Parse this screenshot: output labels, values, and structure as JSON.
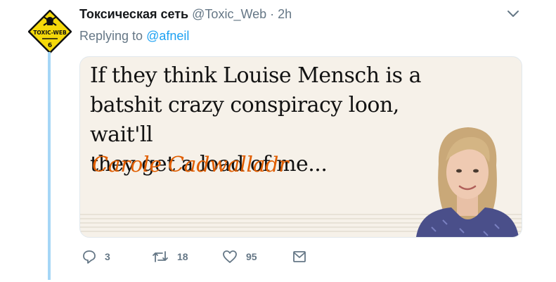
{
  "tweet": {
    "display_name": "Токсическая сеть",
    "handle": "@Toxic_Web",
    "separator": "·",
    "time": "2h",
    "avatar": {
      "icon": "toxic-web-sign-icon",
      "text": "TOXIC-WEB",
      "number": "6",
      "color": "#f5d90a"
    },
    "replying_prefix": "Replying to",
    "replying_handle": "@afneil"
  },
  "card": {
    "quote_line1": "If they think Louise Mensch is a",
    "quote_line2": "batshit crazy conspiracy loon, wait'll",
    "quote_line3": "they get a load of me...",
    "author": "Carole Cadwalladr",
    "author_color": "#e05e00",
    "background": "#f6f1e9"
  },
  "actions": {
    "reply": {
      "icon": "reply-icon",
      "count": "3"
    },
    "retweet": {
      "icon": "retweet-icon",
      "count": "18"
    },
    "like": {
      "icon": "heart-icon",
      "count": "95"
    },
    "dm": {
      "icon": "envelope-icon"
    }
  },
  "colors": {
    "accent": "#1da1f2",
    "muted": "#657786",
    "thread": "#a5d6f6"
  }
}
